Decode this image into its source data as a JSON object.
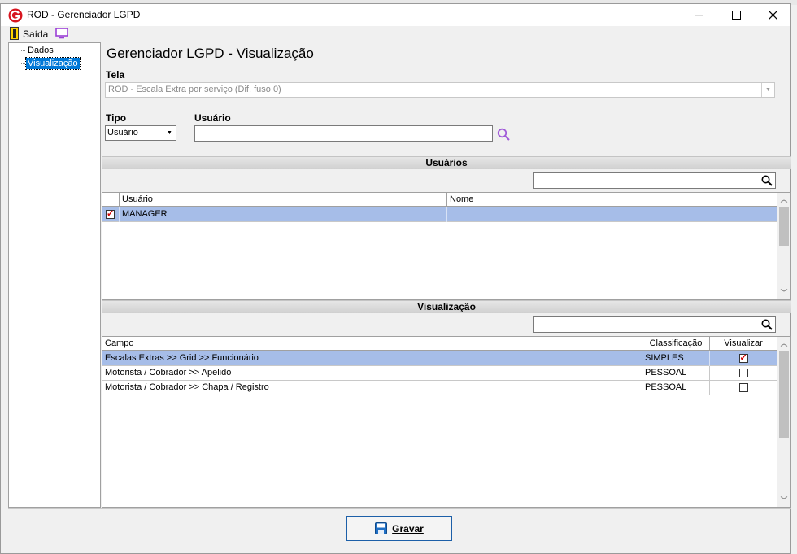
{
  "background_window": {
    "title": "ROD - Escala Extra por serviço (Dif. fuso 0)"
  },
  "window": {
    "title": "ROD - Gerenciador LGPD"
  },
  "toolbar": {
    "exit_label": "Saída"
  },
  "tree": {
    "items": [
      {
        "label": "Dados"
      },
      {
        "label": "Visualização"
      }
    ]
  },
  "main": {
    "heading": "Gerenciador LGPD - Visualização",
    "tela_label": "Tela",
    "tela_value": "ROD - Escala Extra por serviço (Dif. fuso 0)",
    "tipo_label": "Tipo",
    "tipo_value": "Usuário",
    "usuario_label": "Usuário",
    "usuario_value": ""
  },
  "usuarios_section": {
    "title": "Usuários",
    "columns": [
      "Usuário",
      "Nome"
    ],
    "rows": [
      {
        "checked": true,
        "usuario": "MANAGER",
        "nome": ""
      }
    ]
  },
  "visualizacao_section": {
    "title": "Visualização",
    "columns": [
      "Campo",
      "Classificação",
      "Visualizar"
    ],
    "rows": [
      {
        "campo": "Escalas Extras >> Grid >> Funcionário",
        "classificacao": "SIMPLES",
        "visualizar": true
      },
      {
        "campo": "Motorista / Cobrador >> Apelido",
        "classificacao": "PESSOAL",
        "visualizar": false
      },
      {
        "campo": "Motorista / Cobrador >> Chapa / Registro",
        "classificacao": "PESSOAL",
        "visualizar": false
      }
    ]
  },
  "buttons": {
    "save_label": "Gravar"
  },
  "colors": {
    "selection": "#a6bde8",
    "tree_selection": "#0078d7",
    "accent_purple": "#9b3fd6",
    "brand_red": "#d8151f"
  }
}
